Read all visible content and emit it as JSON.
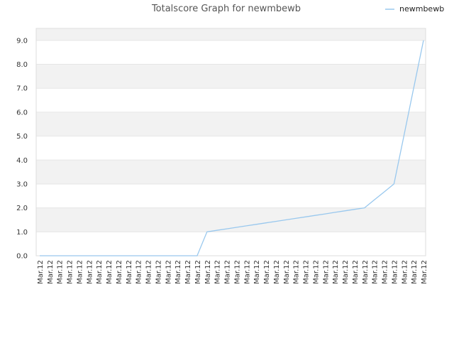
{
  "chart_data": {
    "type": "line",
    "title": "Totalscore Graph for newmbewb",
    "xlabel": "",
    "ylabel": "",
    "ylim": [
      0,
      9.5
    ],
    "yticks": [
      "0.0",
      "1.0",
      "2.0",
      "3.0",
      "4.0",
      "5.0",
      "6.0",
      "7.0",
      "8.0",
      "9.0"
    ],
    "grid": true,
    "band_colors": [
      "#f2f2f2",
      "#ffffff"
    ],
    "legend_position": "top-right",
    "series": [
      {
        "name": "newmbewb",
        "color": "#99c8ee",
        "x": [
          "Mar.12",
          "Mar.12",
          "Mar.12",
          "Mar.12",
          "Mar.12",
          "Mar.12",
          "Mar.12",
          "Mar.12",
          "Mar.12",
          "Mar.12",
          "Mar.12",
          "Mar.12",
          "Mar.12",
          "Mar.12",
          "Mar.12",
          "Mar.12",
          "Mar.12",
          "Mar.12",
          "Mar.12",
          "Mar.12",
          "Mar.12",
          "Mar.12",
          "Mar.12",
          "Mar.12",
          "Mar.12",
          "Mar.12",
          "Mar.12",
          "Mar.12",
          "Mar.12",
          "Mar.12",
          "Mar.12",
          "Mar.12",
          "Mar.12",
          "Mar.12",
          "Mar.12",
          "Mar.12",
          "Mar.12",
          "Mar.12",
          "Mar.12",
          "Mar.12"
        ],
        "values": [
          0,
          0,
          0,
          0,
          0,
          0,
          0,
          0,
          0,
          0,
          0,
          0,
          0,
          0,
          0,
          0,
          0,
          1,
          1.0625,
          1.125,
          1.1875,
          1.25,
          1.3125,
          1.375,
          1.4375,
          1.5,
          1.5625,
          1.625,
          1.6875,
          1.75,
          1.8125,
          1.875,
          1.9375,
          2,
          2.333,
          2.667,
          3,
          5,
          7,
          9
        ]
      }
    ]
  }
}
